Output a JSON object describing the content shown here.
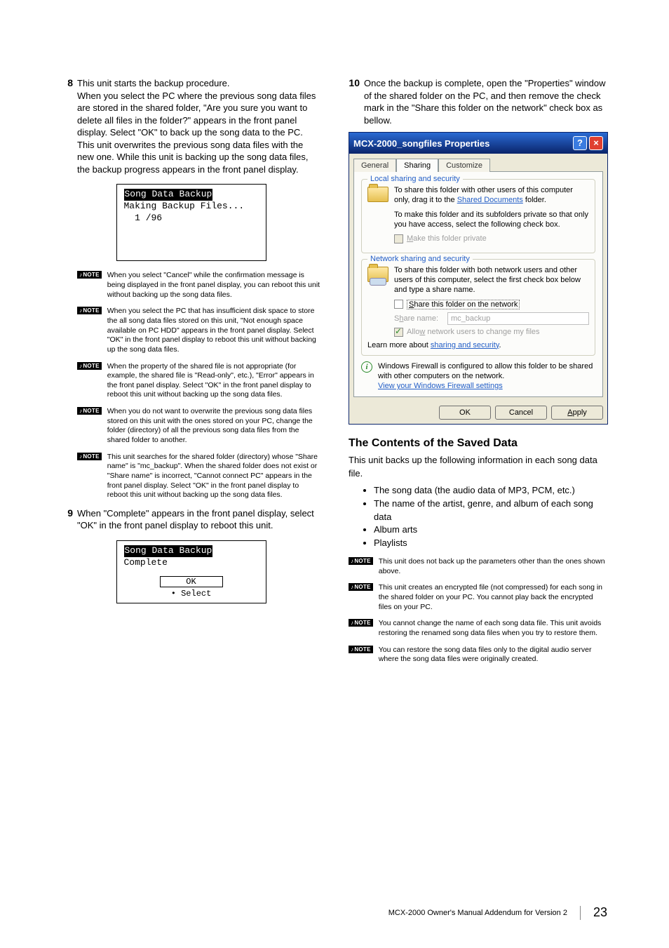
{
  "left": {
    "step8": {
      "num": "8",
      "lead": "This unit starts the backup procedure.",
      "body": "When you select the PC where the previous song data files are stored in the shared folder, \"Are you sure you want to delete all files in the folder?\" appears in the front panel display. Select \"OK\" to back up the song data to the PC. This unit overwrites the previous song data files with the new one. While this unit is backing up the song data files, the backup progress appears in the front panel display."
    },
    "lcd1": {
      "title": "Song Data Backup",
      "line1": "Making Backup Files...",
      "line2": "  1 /96"
    },
    "notes8": [
      "When you select \"Cancel\" while the confirmation message is being displayed in the front panel display, you can reboot this unit without backing up the song data files.",
      "When you select the PC that has insufficient disk space to store the all song data files stored on this unit, \"Not enough space available on PC HDD\" appears in the front panel display. Select \"OK\" in the front panel display to reboot this unit without backing up the song data files.",
      "When the property of the shared file is not appropriate (for example, the shared file is \"Read-only\", etc.), \"Error\" appears in the front panel display. Select \"OK\" in the front panel display to reboot this unit without backing up the song data files.",
      "When you do not want to overwrite the previous song data files stored on this unit with the ones stored on your PC, change the folder (directory) of all the previous song data files from the shared folder to another.",
      "This unit searches for the shared folder (directory) whose \"Share name\" is \"mc_backup\". When the shared folder does not exist or \"Share name\" is incorrect, \"Cannot connect PC\" appears in the front panel display. Select \"OK\" in the front panel display to reboot this unit without backing up the song data files."
    ],
    "step9": {
      "num": "9",
      "body": "When \"Complete\" appears in the front panel display, select \"OK\" in the front panel display to reboot this unit."
    },
    "lcd2": {
      "title": "Song Data Backup",
      "line1": "Complete",
      "ok": "OK",
      "select": "• Select"
    }
  },
  "right": {
    "step10": {
      "num": "10",
      "body": "Once the backup is complete, open the \"Properties\" window of the shared folder on the PC, and then remove the check mark in the \"Share this folder on the network\" check box as bellow."
    },
    "dialog": {
      "title": "MCX-2000_songfiles Properties",
      "tabs": [
        "General",
        "Sharing",
        "Customize"
      ],
      "active_tab": 1,
      "group1": {
        "legend": "Local sharing and security",
        "msg1a": "To share this folder with other users of this computer only, drag it to the ",
        "msg1_link": "Shared Documents",
        "msg1b": " folder.",
        "msg2": "To make this folder and its subfolders private so that only you have access, select the following check box.",
        "check1": "Make this folder private"
      },
      "group2": {
        "legend": "Network sharing and security",
        "msg1": "To share this folder with both network users and other users of this computer, select the first check box below and type a share name.",
        "check_share": "Share this folder on the network",
        "share_label": "Share name:",
        "share_value": "mc_backup",
        "check_allow": "Allow network users to change my files",
        "learn_a": "Learn more about ",
        "learn_link": "sharing and security",
        "learn_b": "."
      },
      "info": {
        "line1": "Windows Firewall is configured to allow this folder to be shared with other computers on the network.",
        "link": "View your Windows Firewall settings"
      },
      "buttons": [
        "OK",
        "Cancel",
        "Apply"
      ]
    },
    "heading": "The Contents of the Saved Data",
    "intro": "This unit backs up the following information in each song data file.",
    "bullets": [
      "The song data (the audio data of MP3, PCM, etc.)",
      "The name of the artist, genre, and album of each song data",
      "Album arts",
      "Playlists"
    ],
    "notes": [
      "This unit does not back up the parameters other than the ones shown above.",
      "This unit creates an encrypted file (not compressed) for each song in the shared folder on your PC. You cannot play back the encrypted files on your PC.",
      "You cannot change the name of each song data file. This unit avoids restoring the renamed song data files when you try to restore them.",
      "You can restore the song data files only to the digital audio server where the song data files were originally created."
    ]
  },
  "note_badge": "NOTE",
  "footer": {
    "text": "MCX-2000 Owner's Manual Addendum for Version 2",
    "page": "23"
  }
}
